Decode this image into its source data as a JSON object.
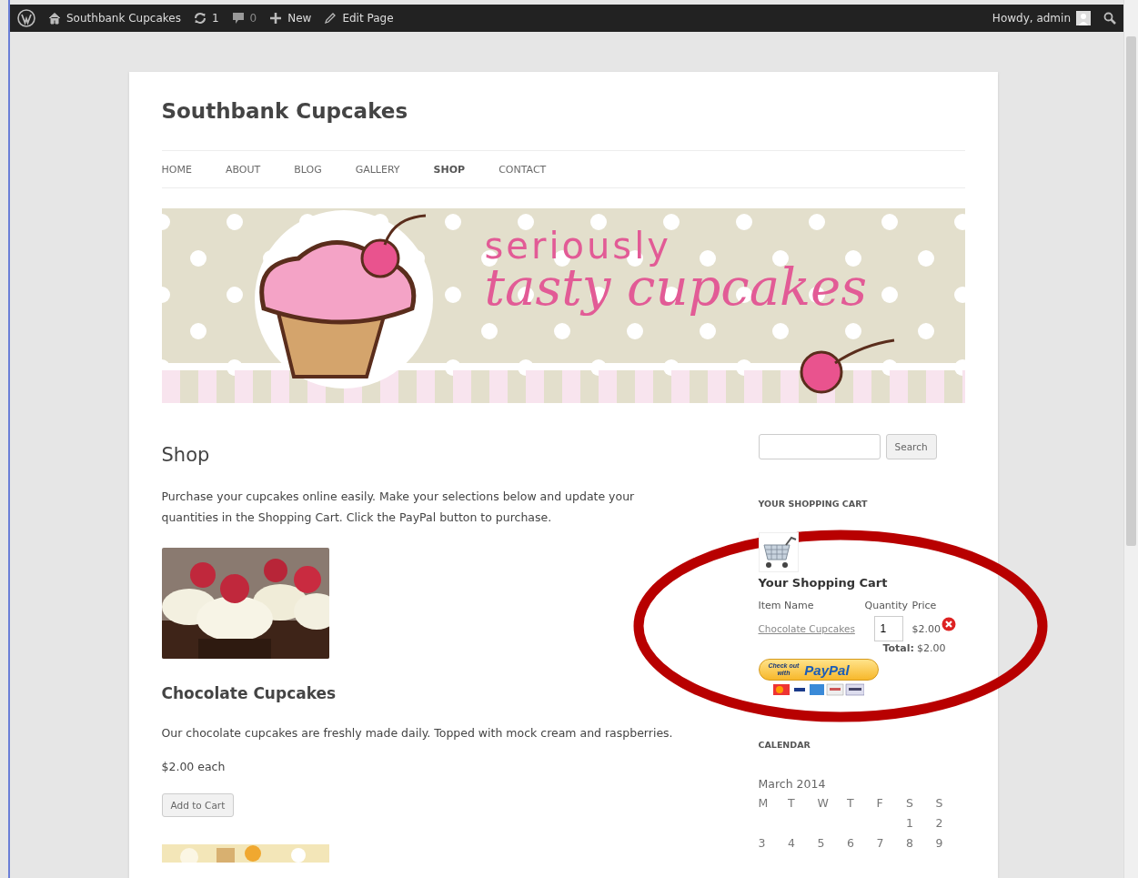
{
  "admin_bar": {
    "site": "Southbank Cupcakes",
    "updates": "1",
    "comments": "0",
    "new": "New",
    "edit": "Edit Page",
    "greeting": "Howdy, admin"
  },
  "site_title": "Southbank Cupcakes",
  "nav": [
    {
      "label": "HOME",
      "selected": false
    },
    {
      "label": "ABOUT",
      "selected": false
    },
    {
      "label": "BLOG",
      "selected": false
    },
    {
      "label": "GALLERY",
      "selected": false
    },
    {
      "label": "SHOP",
      "selected": true
    },
    {
      "label": "CONTACT",
      "selected": false
    }
  ],
  "banner": {
    "line_1": "seriously",
    "line_2": "tasty cupcakes"
  },
  "page_title": "Shop",
  "intro": "Purchase your cupcakes online easily. Make your selections below and update your quantities in the Shopping Cart. Click the PayPal button to purchase.",
  "product": {
    "name": "Chocolate Cupcakes",
    "description": "Our chocolate cupcakes are freshly made daily. Topped with mock cream and raspberries.",
    "price": "$2.00 each",
    "button": "Add to Cart"
  },
  "sidebar": {
    "search_button": "Search",
    "cart_heading": "YOUR SHOPPING CART",
    "cart": {
      "title": "Your Shopping Cart",
      "columns": [
        "Item Name",
        "Quantity",
        "Price"
      ],
      "items": [
        {
          "name": "Chocolate Cupcakes",
          "quantity": "1",
          "price": "$2.00"
        }
      ],
      "total_label": "Total:",
      "total": "$2.00",
      "paypal_line_1": "Check out",
      "paypal_line_2": "with",
      "paypal_brand": "PayPal"
    },
    "calendar_heading": "CALENDAR",
    "calendar": {
      "month": "March 2014",
      "weekdays": [
        "M",
        "T",
        "W",
        "T",
        "F",
        "S",
        "S"
      ],
      "weeks": [
        [
          "1",
          "2"
        ],
        [
          "3",
          "4",
          "5",
          "6",
          "7",
          "8",
          "9"
        ]
      ]
    }
  }
}
